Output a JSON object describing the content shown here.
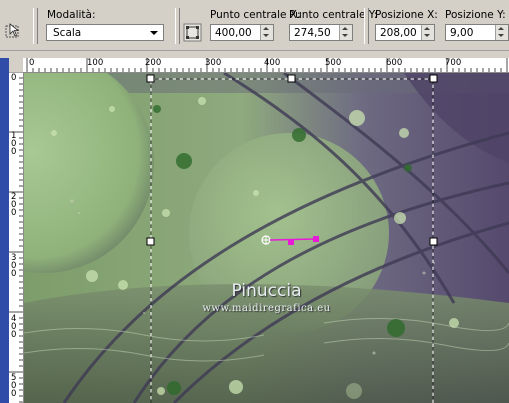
{
  "toolbar": {
    "mode_label": "Modalità:",
    "mode_value": "Scala",
    "center_x_label": "Punto centrale X:",
    "center_x_value": "400,00",
    "center_y_label": "Punto centrale Y:",
    "center_y_value": "274,50",
    "pos_x_label": "Posizione X:",
    "pos_x_value": "208,00",
    "pos_y_label": "Posizione Y:",
    "pos_y_value": "9,00"
  },
  "ruler_top": {
    "labels": [
      "0",
      "100",
      "200",
      "300",
      "400",
      "500",
      "600",
      "700"
    ]
  },
  "ruler_left": {
    "labels": [
      "0",
      "100",
      "200",
      "300",
      "400",
      "500"
    ]
  },
  "canvas": {
    "watermark_title": "Pinuccia",
    "watermark_url": "www.maidiregrafica.eu"
  },
  "colors": {
    "selection": "#ffffff",
    "handle_magenta": "#e81ad8",
    "bg_green": "#8fb27a",
    "bg_purple": "#5a4d73",
    "sidebar_blue": "#2f4da8"
  }
}
